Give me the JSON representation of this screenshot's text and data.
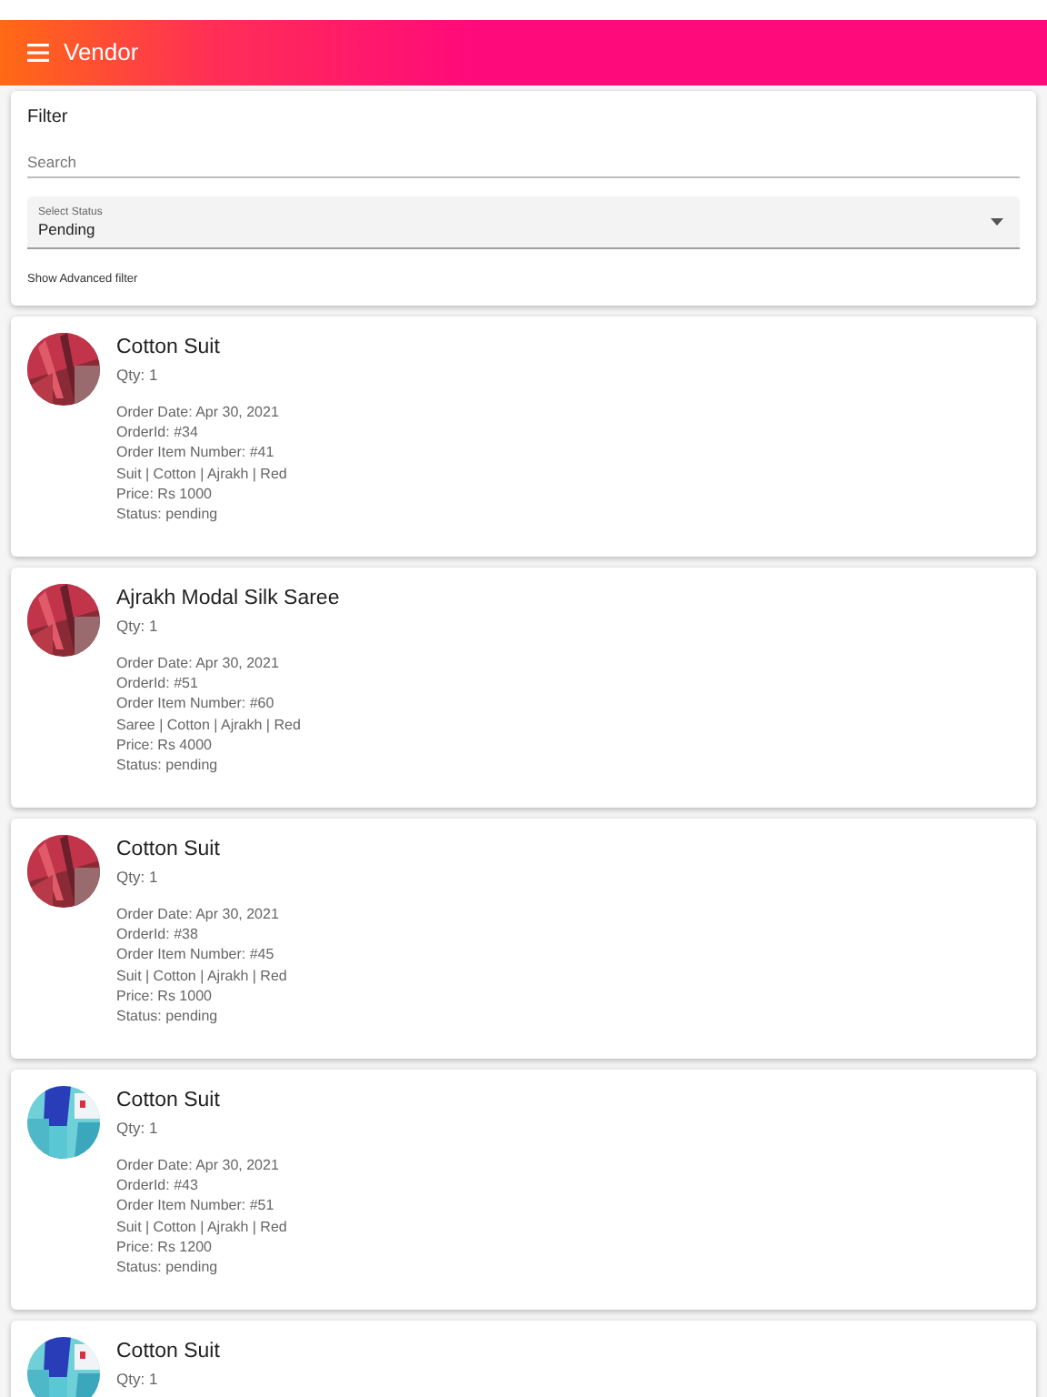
{
  "app_bar": {
    "title": "Vendor"
  },
  "filter": {
    "title": "Filter",
    "search": {
      "placeholder": "Search"
    },
    "status_select": {
      "label": "Select Status",
      "value": "Pending"
    },
    "advanced_link": "Show Advanced filter"
  },
  "orders": [
    {
      "title": "Cotton Suit",
      "qty": "Qty: 1",
      "details": [
        "Order Date: Apr 30, 2021",
        "OrderId: #34",
        "Order Item Number: #41",
        "Suit | Cotton | Ajrakh | Red",
        "Price: Rs 1000",
        "Status: pending"
      ]
    },
    {
      "title": "Ajrakh Modal Silk Saree",
      "qty": "Qty: 1",
      "details": [
        "Order Date: Apr 30, 2021",
        "OrderId: #51",
        "Order Item Number: #60",
        "Saree | Cotton | Ajrakh | Red",
        "Price: Rs 4000",
        "Status: pending"
      ]
    },
    {
      "title": "Cotton Suit",
      "qty": "Qty: 1",
      "details": [
        "Order Date: Apr 30, 2021",
        "OrderId: #38",
        "Order Item Number: #45",
        "Suit | Cotton | Ajrakh | Red",
        "Price: Rs 1000",
        "Status: pending"
      ]
    },
    {
      "title": "Cotton Suit",
      "qty": "Qty: 1",
      "details": [
        "Order Date: Apr 30, 2021",
        "OrderId: #43",
        "Order Item Number: #51",
        "Suit | Cotton | Ajrakh | Red",
        "Price: Rs 1200",
        "Status: pending"
      ]
    },
    {
      "title": "Cotton Suit",
      "qty": "Qty: 1"
    }
  ]
}
